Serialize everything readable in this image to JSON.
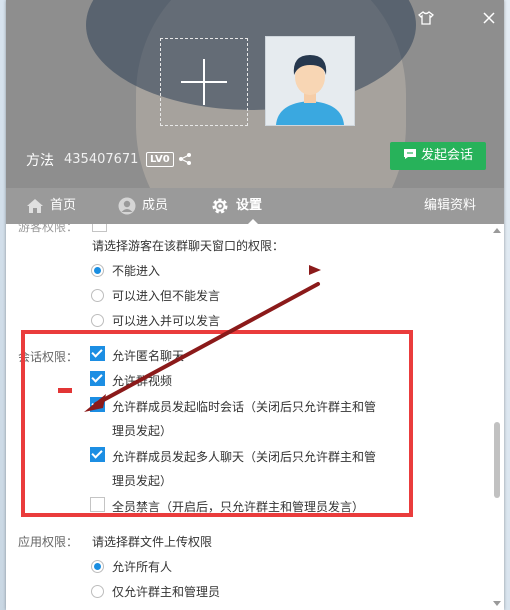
{
  "header": {
    "group_name": "方法",
    "group_id": "435407671",
    "level_badge": "LV0",
    "start_chat_label": "发起会话",
    "window_controls": [
      "shirt-icon",
      "close-icon"
    ]
  },
  "tabs": [
    {
      "label": "首页",
      "icon": "home-icon"
    },
    {
      "label": "成员",
      "icon": "user-icon"
    },
    {
      "label": "设置",
      "icon": "gear-icon",
      "active": true
    }
  ],
  "edit_profile_label": "编辑资料",
  "guest_section": {
    "prompt": "请选择游客在该群聊天窗口的权限：",
    "options": [
      {
        "label": "不能进入",
        "selected": true
      },
      {
        "label": "可以进入但不能发言",
        "selected": false
      },
      {
        "label": "可以进入并可以发言",
        "selected": false
      }
    ]
  },
  "session_section": {
    "label": "会话权限：",
    "options": [
      {
        "label": "允许匿名聊天",
        "checked": true
      },
      {
        "label": "允许群视频",
        "checked": true
      },
      {
        "label": "允许群成员发起临时会话（关闭后只允许群主和管",
        "label_cont": "理员发起）",
        "checked": true
      },
      {
        "label": "允许群成员发起多人聊天（关闭后只允许群主和管",
        "label_cont": "理员发起）",
        "checked": true
      },
      {
        "label": "全员禁言（开启后，只允许群主和管理员发言）",
        "checked": false
      }
    ]
  },
  "app_section": {
    "label": "应用权限：",
    "prompt": "请选择群文件上传权限",
    "options": [
      {
        "label": "允许所有人",
        "selected": true
      },
      {
        "label": "仅允许群主和管理员",
        "selected": false
      }
    ]
  },
  "colors": {
    "accent_green": "#27b25a",
    "checkbox_blue": "#1c8ee3",
    "annotation_red": "#ea3c3c",
    "annotation_arrow": "#8b1a1a"
  }
}
